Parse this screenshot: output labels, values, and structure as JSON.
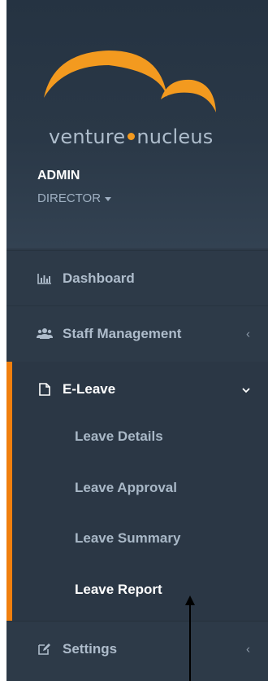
{
  "brand": {
    "logo_text_left": "venture",
    "logo_text_right": "nucleus",
    "accent_color": "#f39a1f"
  },
  "user": {
    "name": "ADMIN",
    "role": "DIRECTOR"
  },
  "nav": {
    "dashboard": {
      "label": "Dashboard",
      "icon": "bar-chart-icon"
    },
    "staff": {
      "label": "Staff Management",
      "icon": "users-icon",
      "chevron": "‹"
    },
    "eleave": {
      "label": "E-Leave",
      "icon": "file-icon",
      "chevron": "⌄",
      "items": [
        {
          "label": "Leave Details"
        },
        {
          "label": "Leave Approval"
        },
        {
          "label": "Leave Summary"
        },
        {
          "label": "Leave Report"
        }
      ]
    },
    "settings": {
      "label": "Settings",
      "icon": "edit-icon",
      "chevron": "‹"
    }
  },
  "colors": {
    "sidebar_bg": "#2d3a48",
    "active_bar": "#f07f0e",
    "text_muted": "#aebccb"
  }
}
